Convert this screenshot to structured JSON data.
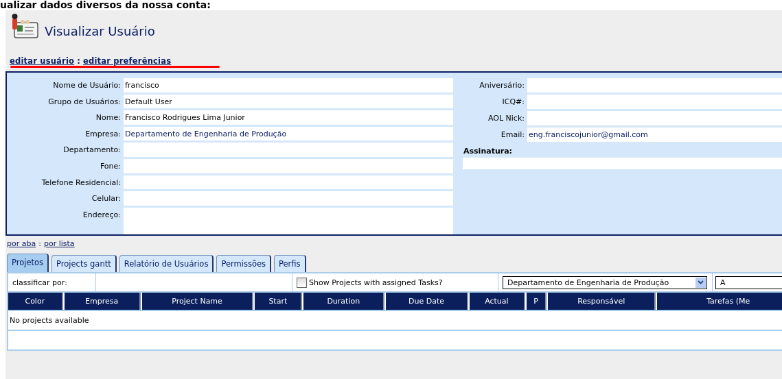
{
  "page_heading": "ualizar dados diversos da nossa conta:",
  "title": "Visualizar Usuário",
  "edit_links": {
    "items": [
      "editar usuário",
      "editar preferências"
    ],
    "separator": ":"
  },
  "details": {
    "left_fields": [
      {
        "label": "Nome de Usuário:",
        "value": "francisco"
      },
      {
        "label": "Grupo de Usuários:",
        "value": "Default User"
      },
      {
        "label": "Nome:",
        "value": "Francisco Rodrigues Lima Junior"
      },
      {
        "label": "Empresa:",
        "value": "Departamento de Engenharia de Produção",
        "kind": "link"
      },
      {
        "label": "Departamento:"
      },
      {
        "label": "Fone:"
      },
      {
        "label": "Telefone Residencial:"
      },
      {
        "label": "Celular:"
      },
      {
        "label": "Endereço:",
        "kind": "multiline"
      }
    ],
    "right_fields": [
      {
        "label": "Aniversário:"
      },
      {
        "label": "ICQ#:"
      },
      {
        "label": "AOL Nick:"
      },
      {
        "label": "Email:",
        "value": "eng.franciscojunior@gmail.com",
        "kind": "link"
      }
    ],
    "signature": {
      "label": "Assinatura:"
    }
  },
  "view_links": {
    "items": [
      "por aba",
      "por lista"
    ],
    "separator": ":"
  },
  "tabs": [
    {
      "label": "Projetos",
      "selected": true
    },
    {
      "label": "Projects gantt",
      "selected": false
    },
    {
      "label": "Relatório de Usuários",
      "selected": false
    },
    {
      "label": "Permissões",
      "selected": false
    },
    {
      "label": "Perfis",
      "selected": false
    }
  ],
  "filter": {
    "sort_label": "classificar por:",
    "show_assigned": {
      "label": "Show Projects with assigned Tasks?",
      "checked": false
    },
    "company_select": {
      "value": "Departamento de Engenharia de Produção"
    },
    "second_select": {
      "value": "A"
    }
  },
  "table": {
    "columns": [
      "Color",
      "Empresa",
      "Project Name",
      "Start",
      "Duration",
      "Due Date",
      "Actual",
      "P",
      "Responsável",
      "Tarefas (Me"
    ],
    "empty_message": "No projects available"
  }
}
